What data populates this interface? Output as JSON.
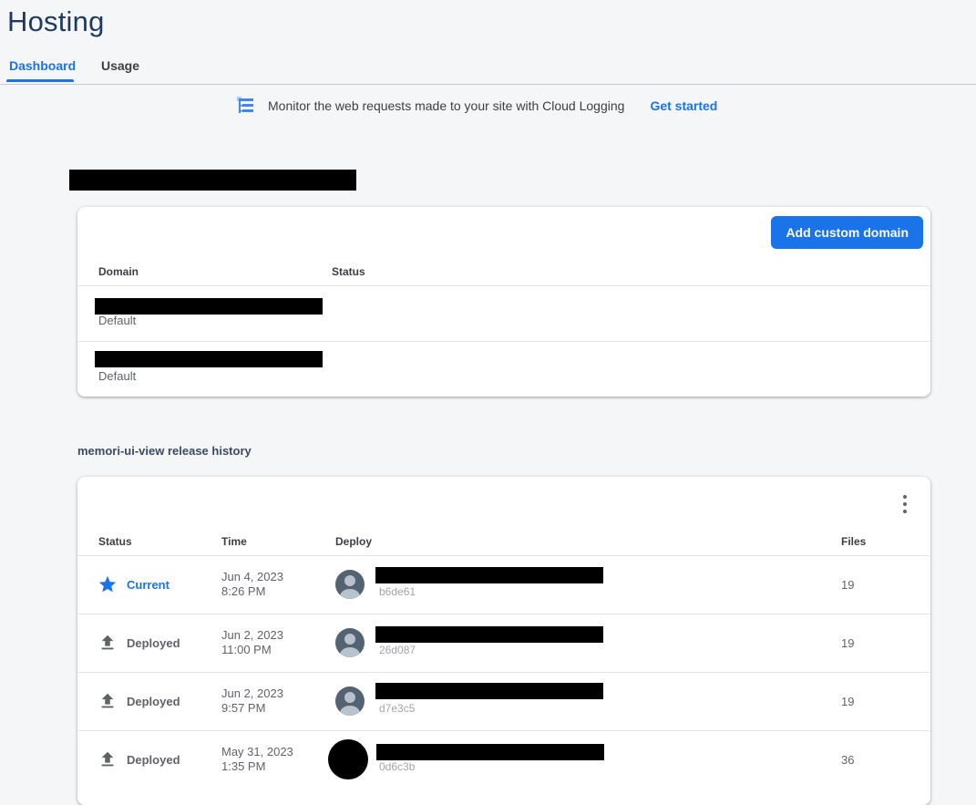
{
  "page": {
    "title": "Hosting"
  },
  "tabs": [
    {
      "label": "Dashboard",
      "active": true
    },
    {
      "label": "Usage",
      "active": false
    }
  ],
  "banner": {
    "text": "Monitor the web requests made to your site with Cloud Logging",
    "link": "Get started",
    "icon": "cloud-logging-icon"
  },
  "domains": {
    "add_button": "Add custom domain",
    "columns": [
      "Domain",
      "Status"
    ],
    "rows": [
      {
        "sub": "Default"
      },
      {
        "sub": "Default"
      }
    ]
  },
  "history": {
    "title": "memori-ui-view release history",
    "columns": [
      "Status",
      "Time",
      "Deploy",
      "Files"
    ],
    "rows": [
      {
        "status": "Current",
        "date": "Jun 4, 2023",
        "time": "8:26 PM",
        "hash": "b6de61",
        "files": "19",
        "icon": "star-icon"
      },
      {
        "status": "Deployed",
        "date": "Jun 2, 2023",
        "time": "11:00 PM",
        "hash": "26d087",
        "files": "19",
        "icon": "upload-icon"
      },
      {
        "status": "Deployed",
        "date": "Jun 2, 2023",
        "time": "9:57 PM",
        "hash": "d7e3c5",
        "files": "19",
        "icon": "upload-icon"
      },
      {
        "status": "Deployed",
        "date": "May 31, 2023",
        "time": "1:35 PM",
        "hash": "0d6c3b",
        "files": "36",
        "icon": "upload-icon"
      }
    ]
  },
  "colors": {
    "accent": "#1a73e8",
    "title": "#1f3a5f",
    "background": "#f5f6f8"
  }
}
